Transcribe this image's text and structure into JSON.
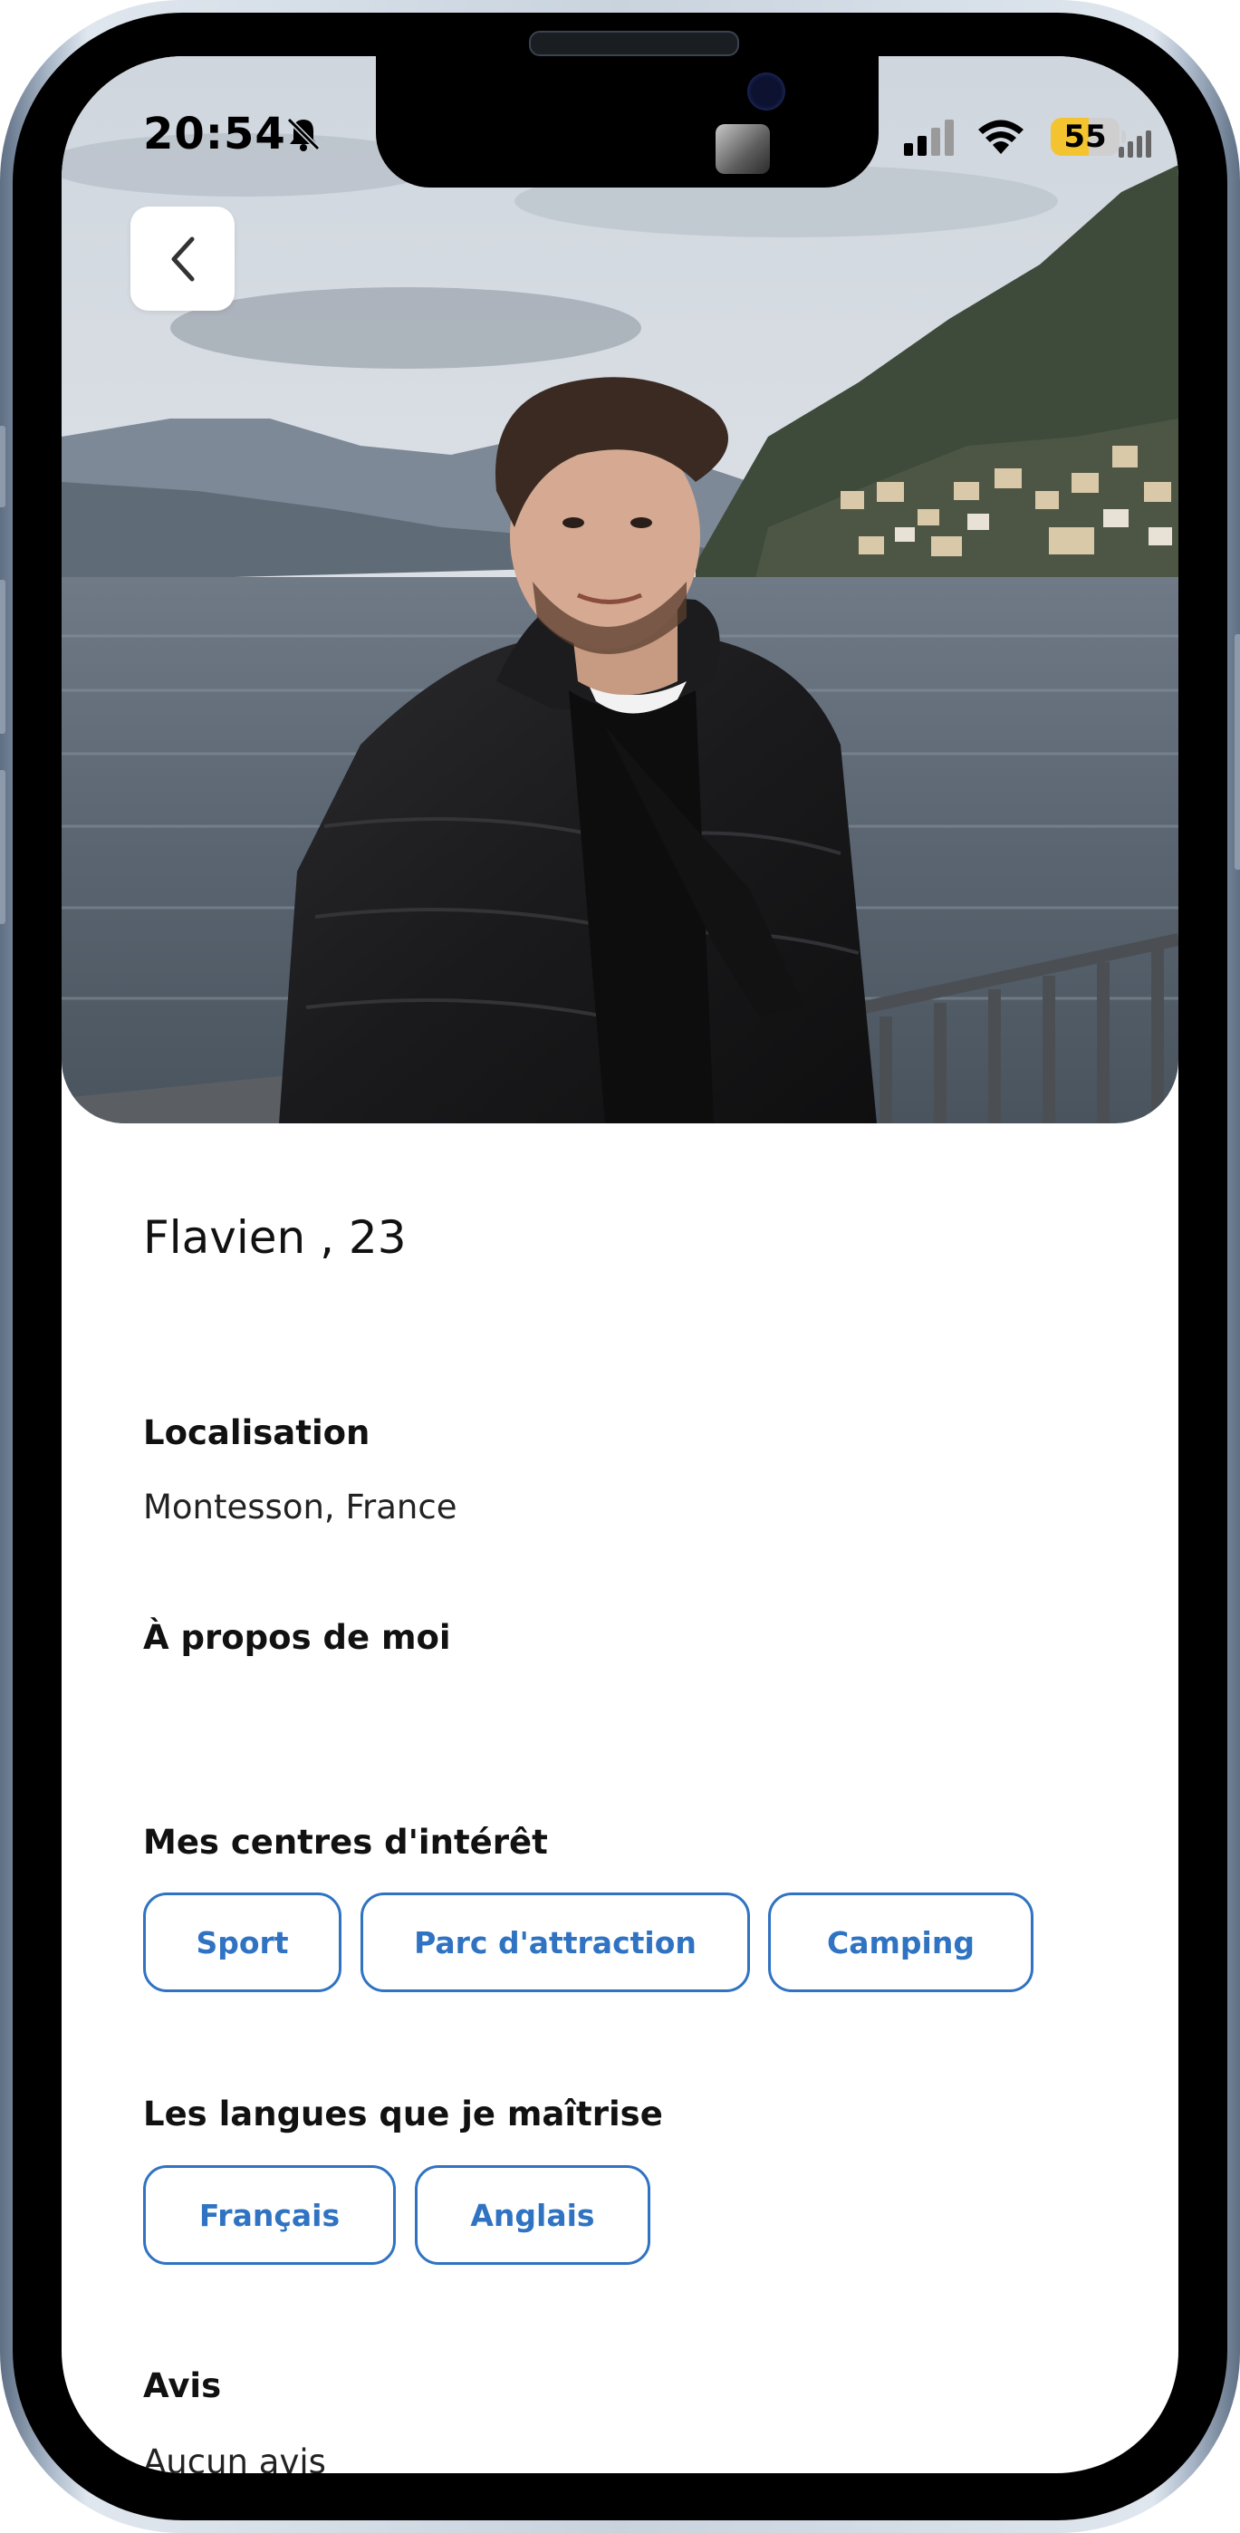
{
  "status_bar": {
    "time": "20:54",
    "battery_level": "55",
    "battery_fraction": 0.55,
    "icons": [
      "bell-slash-icon",
      "cellular-signal-icon",
      "wifi-icon",
      "battery-icon"
    ]
  },
  "header": {
    "back_icon": "chevron-left-icon"
  },
  "profile": {
    "name_age": "Flavien , 23",
    "location_title": "Localisation",
    "location_value": "Montesson, France",
    "about_title": "À propos de moi",
    "interests_title": "Mes centres d'intérêt",
    "interests": [
      "Sport",
      "Parc d'attraction",
      "Camping"
    ],
    "languages_title": "Les langues que je maîtrise",
    "languages": [
      "Français",
      "Anglais"
    ],
    "reviews_title": "Avis",
    "reviews_value": "Aucun avis"
  },
  "colors": {
    "accent": "#2f73c2",
    "battery": "#f4c430"
  }
}
